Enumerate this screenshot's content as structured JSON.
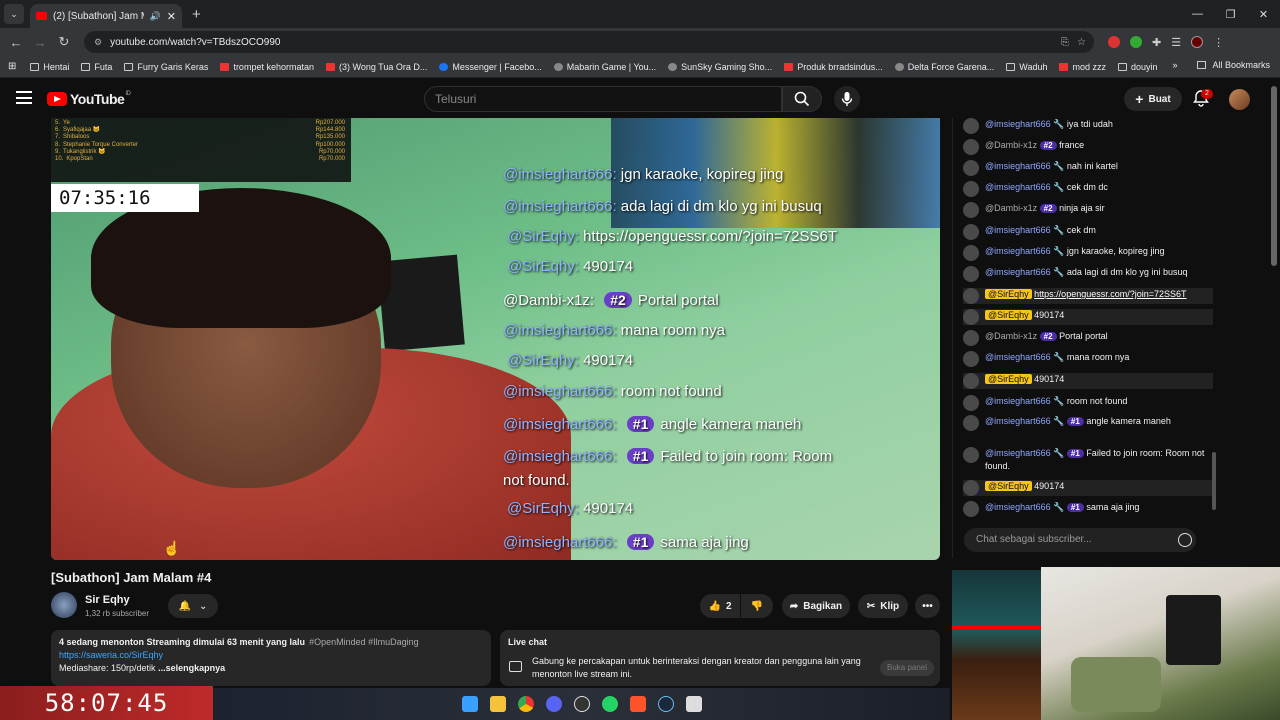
{
  "browser": {
    "tab_title": "(2) [Subathon] Jam Malam #",
    "url": "youtube.com/watch?v=TBdszOCO990",
    "bookmarks": [
      "Hentai",
      "Futa",
      "Furry Garis Keras",
      "trompet kehormatan",
      "(3) Wong Tua Ora D...",
      "Messenger | Facebo...",
      "Mabarin Game | You...",
      "SunSky Gaming Sho...",
      "Produk brradsindus...",
      "Delta Force Garena...",
      "Waduh",
      "mod zzz",
      "douyin"
    ],
    "all_bookmarks": "All Bookmarks"
  },
  "youtube": {
    "logo": "YouTube",
    "logo_region": "ID",
    "search_placeholder": "Telusuri",
    "create_label": "Buat",
    "notification_count": "2"
  },
  "video_overlay": {
    "leaderboard": [
      {
        "rank": "5.",
        "name": "Ye",
        "amount": "Rp207.000"
      },
      {
        "rank": "6.",
        "name": "Syafiqajaa 🐱",
        "amount": "Rp144.800"
      },
      {
        "rank": "7.",
        "name": "Shibaloos",
        "amount": "Rp135.000"
      },
      {
        "rank": "8.",
        "name": "Stephanie Torque Converter",
        "amount": "Rp100.000"
      },
      {
        "rank": "9.",
        "name": "Tukanglistrik 🐱",
        "amount": "Rp70.000"
      },
      {
        "rank": "10.",
        "name": "KpopStan",
        "amount": "Rp70.000"
      }
    ],
    "timer": "07:35:16",
    "chat": [
      {
        "user": "@imsieghart666:",
        "badge": "",
        "text": "jgn karaoke, kopireg jing"
      },
      {
        "user": "@imsieghart666:",
        "badge": "",
        "text": "ada lagi di dm klo yg ini busuq"
      },
      {
        "user": "@SirEqhy:",
        "badge": "",
        "text": "https://openguessr.com/?join=72SS6T"
      },
      {
        "user": "@SirEqhy:",
        "badge": "",
        "text": "490174"
      },
      {
        "user": "@Dambi-x1z:",
        "badge": "#2",
        "text": "Portal portal"
      },
      {
        "user": "@imsieghart666:",
        "badge": "",
        "text": "mana room nya"
      },
      {
        "user": "@SirEqhy:",
        "badge": "",
        "text": "490174"
      },
      {
        "user": "@imsieghart666:",
        "badge": "",
        "text": "room not found"
      },
      {
        "user": "@imsieghart666:",
        "badge": "#1",
        "text": "angle kamera maneh"
      },
      {
        "user": "@imsieghart666:",
        "badge": "#1",
        "text": "Failed to join room: Room"
      },
      {
        "user": "",
        "badge": "",
        "text": "not found."
      },
      {
        "user": "@SirEqhy:",
        "badge": "",
        "text": "490174"
      },
      {
        "user": "@imsieghart666:",
        "badge": "#1",
        "text": "sama aja jing"
      }
    ]
  },
  "live_chat": {
    "messages": [
      {
        "author": "@imsieghart666 🔧",
        "badge": "",
        "text": "iya tdi udah",
        "owner": false
      },
      {
        "author": "@Dambi-x1z",
        "badge": "#2",
        "text": "france",
        "owner": false
      },
      {
        "author": "@imsieghart666 🔧",
        "badge": "",
        "text": "nah ini kartel",
        "owner": false
      },
      {
        "author": "@imsieghart666 🔧",
        "badge": "",
        "text": "cek dm dc",
        "owner": false
      },
      {
        "author": "@Dambi-x1z",
        "badge": "#2",
        "text": "ninja aja sir",
        "owner": false
      },
      {
        "author": "@imsieghart666 🔧",
        "badge": "",
        "text": "cek dm",
        "owner": false
      },
      {
        "author": "@imsieghart666 🔧",
        "badge": "",
        "text": "jgn karaoke, kopireg jing",
        "owner": false
      },
      {
        "author": "@imsieghart666 🔧",
        "badge": "",
        "text": "ada lagi di dm klo yg ini busuq",
        "owner": false
      },
      {
        "author": "@SirEqhy",
        "badge": "",
        "text": "https://openguessr.com/?join=72SS6T",
        "owner": true
      },
      {
        "author": "@SirEqhy",
        "badge": "",
        "text": "490174",
        "owner": true
      },
      {
        "author": "@Dambi-x1z",
        "badge": "#2",
        "text": "Portal portal",
        "owner": false
      },
      {
        "author": "@imsieghart666 🔧",
        "badge": "",
        "text": "mana room nya",
        "owner": false
      },
      {
        "author": "@SirEqhy",
        "badge": "",
        "text": "490174",
        "owner": true
      },
      {
        "author": "@imsieghart666 🔧",
        "badge": "",
        "text": "room not found",
        "owner": false
      },
      {
        "author": "@imsieghart666 🔧",
        "badge": "#1",
        "text": "angle kamera maneh",
        "owner": false
      },
      {
        "author": "@imsieghart666 🔧",
        "badge": "#1",
        "text": "Failed to join room: Room not found.",
        "owner": false
      },
      {
        "author": "@SirEqhy",
        "badge": "",
        "text": "490174",
        "owner": true
      },
      {
        "author": "@imsieghart666 🔧",
        "badge": "#1",
        "text": "sama aja jing",
        "owner": false
      }
    ],
    "input_placeholder": "Chat sebagai subscriber..."
  },
  "video_info": {
    "title": "[Subathon] Jam Malam #4",
    "channel": "Sir Eqhy",
    "subscribers": "1,32 rb subscriber",
    "likes": "2",
    "share_label": "Bagikan",
    "clip_label": "Klip"
  },
  "description": {
    "stats": "4 sedang menonton  Streaming dimulai 63 menit yang lalu",
    "tags": "#OpenMinded #IlmuDaging",
    "link": "https://saweria.co/SirEqhy",
    "line3": "Mediashare: 150rp/detik",
    "more": "...selengkapnya"
  },
  "live_chat_box": {
    "title": "Live chat",
    "body": "Gabung ke percakapan untuk berinteraksi dengan kreator dan pengguna lain yang menonton live stream ini.",
    "open_panel": "Buka panel"
  },
  "stream_overlay": {
    "big_timer": "58:07:45"
  },
  "colors": {
    "yt_red": "#ff0000",
    "member_badge": "#6a3fc8",
    "owner_highlight": "#f5c518",
    "link": "#3ea6ff"
  }
}
